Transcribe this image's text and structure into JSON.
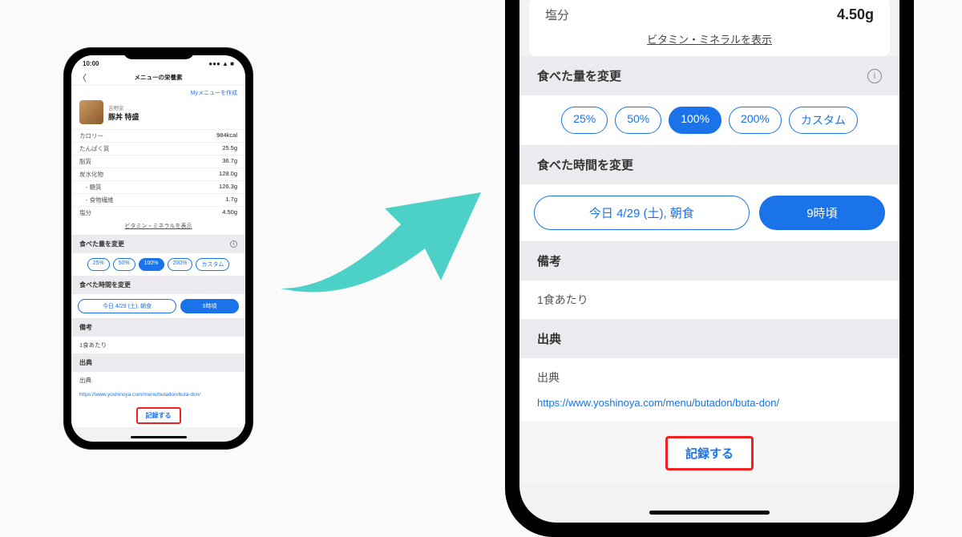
{
  "statusbar": {
    "time": "10:00"
  },
  "header": {
    "title": "メニューの栄養素"
  },
  "mymenu_link": "Myメニューを作成",
  "food": {
    "brand": "吉野家",
    "name": "豚丼 特盛"
  },
  "nutrition": {
    "calorie_label": "カロリー",
    "calorie": "984kcal",
    "protein_label": "たんぱく質",
    "protein": "25.5g",
    "fat_label": "脂質",
    "fat": "36.7g",
    "carb_label": "炭水化物",
    "carb": "128.0g",
    "sugar_label": "- 糖質",
    "sugar": "126.3g",
    "fiber_label": "- 食物繊維",
    "fiber": "1.7g",
    "salt_label": "塩分",
    "salt": "4.50g",
    "vitamin_link": "ビタミン・ミネラルを表示"
  },
  "amount": {
    "title": "食べた量を変更",
    "p25": "25%",
    "p50": "50%",
    "p100": "100%",
    "p200": "200%",
    "custom": "カスタム"
  },
  "time": {
    "title": "食べた時間を変更",
    "date_meal": "今日 4/29 (土), 朝食",
    "hour": "9時頃"
  },
  "notes": {
    "title": "備考",
    "value": "1食あたり"
  },
  "source": {
    "title": "出典",
    "label": "出典",
    "url": "https://www.yoshinoya.com/menu/butadon/buta-don/"
  },
  "record_button": "記録する"
}
